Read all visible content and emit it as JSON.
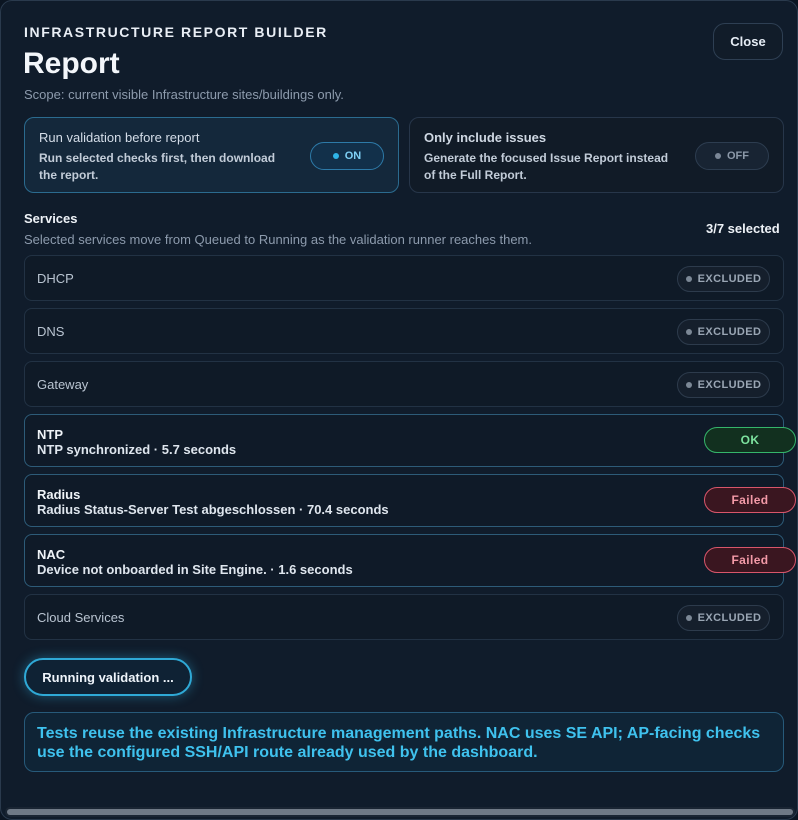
{
  "header": {
    "eyebrow": "INFRASTRUCTURE REPORT BUILDER",
    "title": "Report",
    "scope": "Scope: current visible Infrastructure sites/buildings only.",
    "close_label": "Close"
  },
  "options": {
    "validation": {
      "title": "Run validation before report",
      "description": "Run selected checks first, then download the report.",
      "toggle": "ON"
    },
    "issues_only": {
      "title": "Only include issues",
      "description": "Generate the focused Issue Report instead of the Full Report.",
      "toggle": "OFF"
    }
  },
  "services": {
    "heading": "Services",
    "subtitle": "Selected services move from Queued to Running as the validation runner reaches them.",
    "count": "3/7 selected",
    "items": [
      {
        "name": "DHCP",
        "status": "EXCLUDED"
      },
      {
        "name": "DNS",
        "status": "EXCLUDED"
      },
      {
        "name": "Gateway",
        "status": "EXCLUDED"
      },
      {
        "name": "NTP",
        "detail": "NTP synchronized · 5.7 seconds",
        "status": "OK"
      },
      {
        "name": "Radius",
        "detail": "Radius Status-Server Test abgeschlossen · 70.4 seconds",
        "status": "Failed"
      },
      {
        "name": "NAC",
        "detail": "Device not onboarded in Site Engine. · 1.6 seconds",
        "status": "Failed"
      },
      {
        "name": "Cloud Services",
        "status": "EXCLUDED"
      }
    ]
  },
  "run_button_label": "Running validation ...",
  "info_note": "Tests reuse the existing Infrastructure management paths. NAC uses SE API; AP-facing checks use the configured SSH/API route already used by the dashboard.",
  "colors": {
    "accent": "#2fa9d6",
    "ok": "#35b56a",
    "failed": "#d9556a",
    "background": "#101c2b"
  }
}
